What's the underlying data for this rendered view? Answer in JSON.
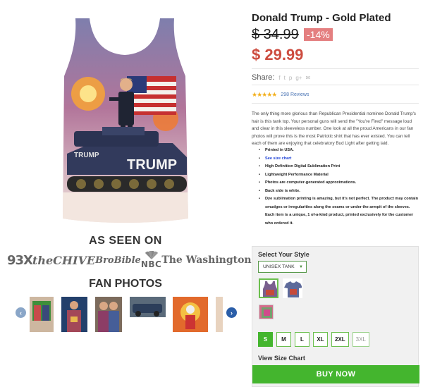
{
  "product": {
    "title": "Donald Trump - Gold Plated",
    "old_price": "$ 34.99",
    "discount": "-14%",
    "price": "$ 29.99",
    "image_text": "TRUMP"
  },
  "share": {
    "label": "Share:",
    "icons": [
      "facebook-icon",
      "twitter-icon",
      "pinterest-icon",
      "google-plus-icon",
      "email-icon"
    ]
  },
  "rating": {
    "stars": "★★★★★",
    "reviews": "298 Reviews"
  },
  "description": "The only thing more glorious than Republican Presidential nominee Donald Trump's hair is this tank top. Your personal guns will send the \"You're Fired\" message loud and clear in this sleeveless number. One look at all the proud Americans in our fan photos will prove this is the most Patriotic shirt that has ever existed. You can tell each of them are enjoying that celebratory Bud Light after getting laid.",
  "features": [
    "Printed in USA.",
    "See size chart",
    "High Definition Digital Sublimation Print",
    "Lightweight Performance Material",
    "Photos are computer-generated approximations.",
    "Back side is white.",
    "Dye sublimation printing is amazing, but it's not perfect. The product may contain smudges or irregularities along the seams or under the armpit of the sleeves. Each item is a unique, 1 of-a-kind product, printed exclusively for the customer who ordered it."
  ],
  "as_seen_on": {
    "heading": "AS SEEN ON",
    "logos": [
      "93X",
      "theCHIVE",
      "BroBible",
      "NBC",
      "The Washington Post"
    ]
  },
  "fan_photos": {
    "heading": "FAN PHOTOS",
    "prev_arrow": "‹",
    "next_arrow": "›"
  },
  "selector": {
    "label": "Select Your Style",
    "style_value": "UNISEX TANK",
    "sizes": [
      "S",
      "M",
      "L",
      "XL",
      "2XL",
      "3XL"
    ],
    "selected_size": "S",
    "size_chart_label": "View Size Chart",
    "buy_label": "BUY NOW"
  },
  "colors": {
    "price_red": "#cd4c3f",
    "discount_bg": "#e47f80",
    "accent_green": "#44b52e",
    "link_blue": "#4a74b4"
  }
}
